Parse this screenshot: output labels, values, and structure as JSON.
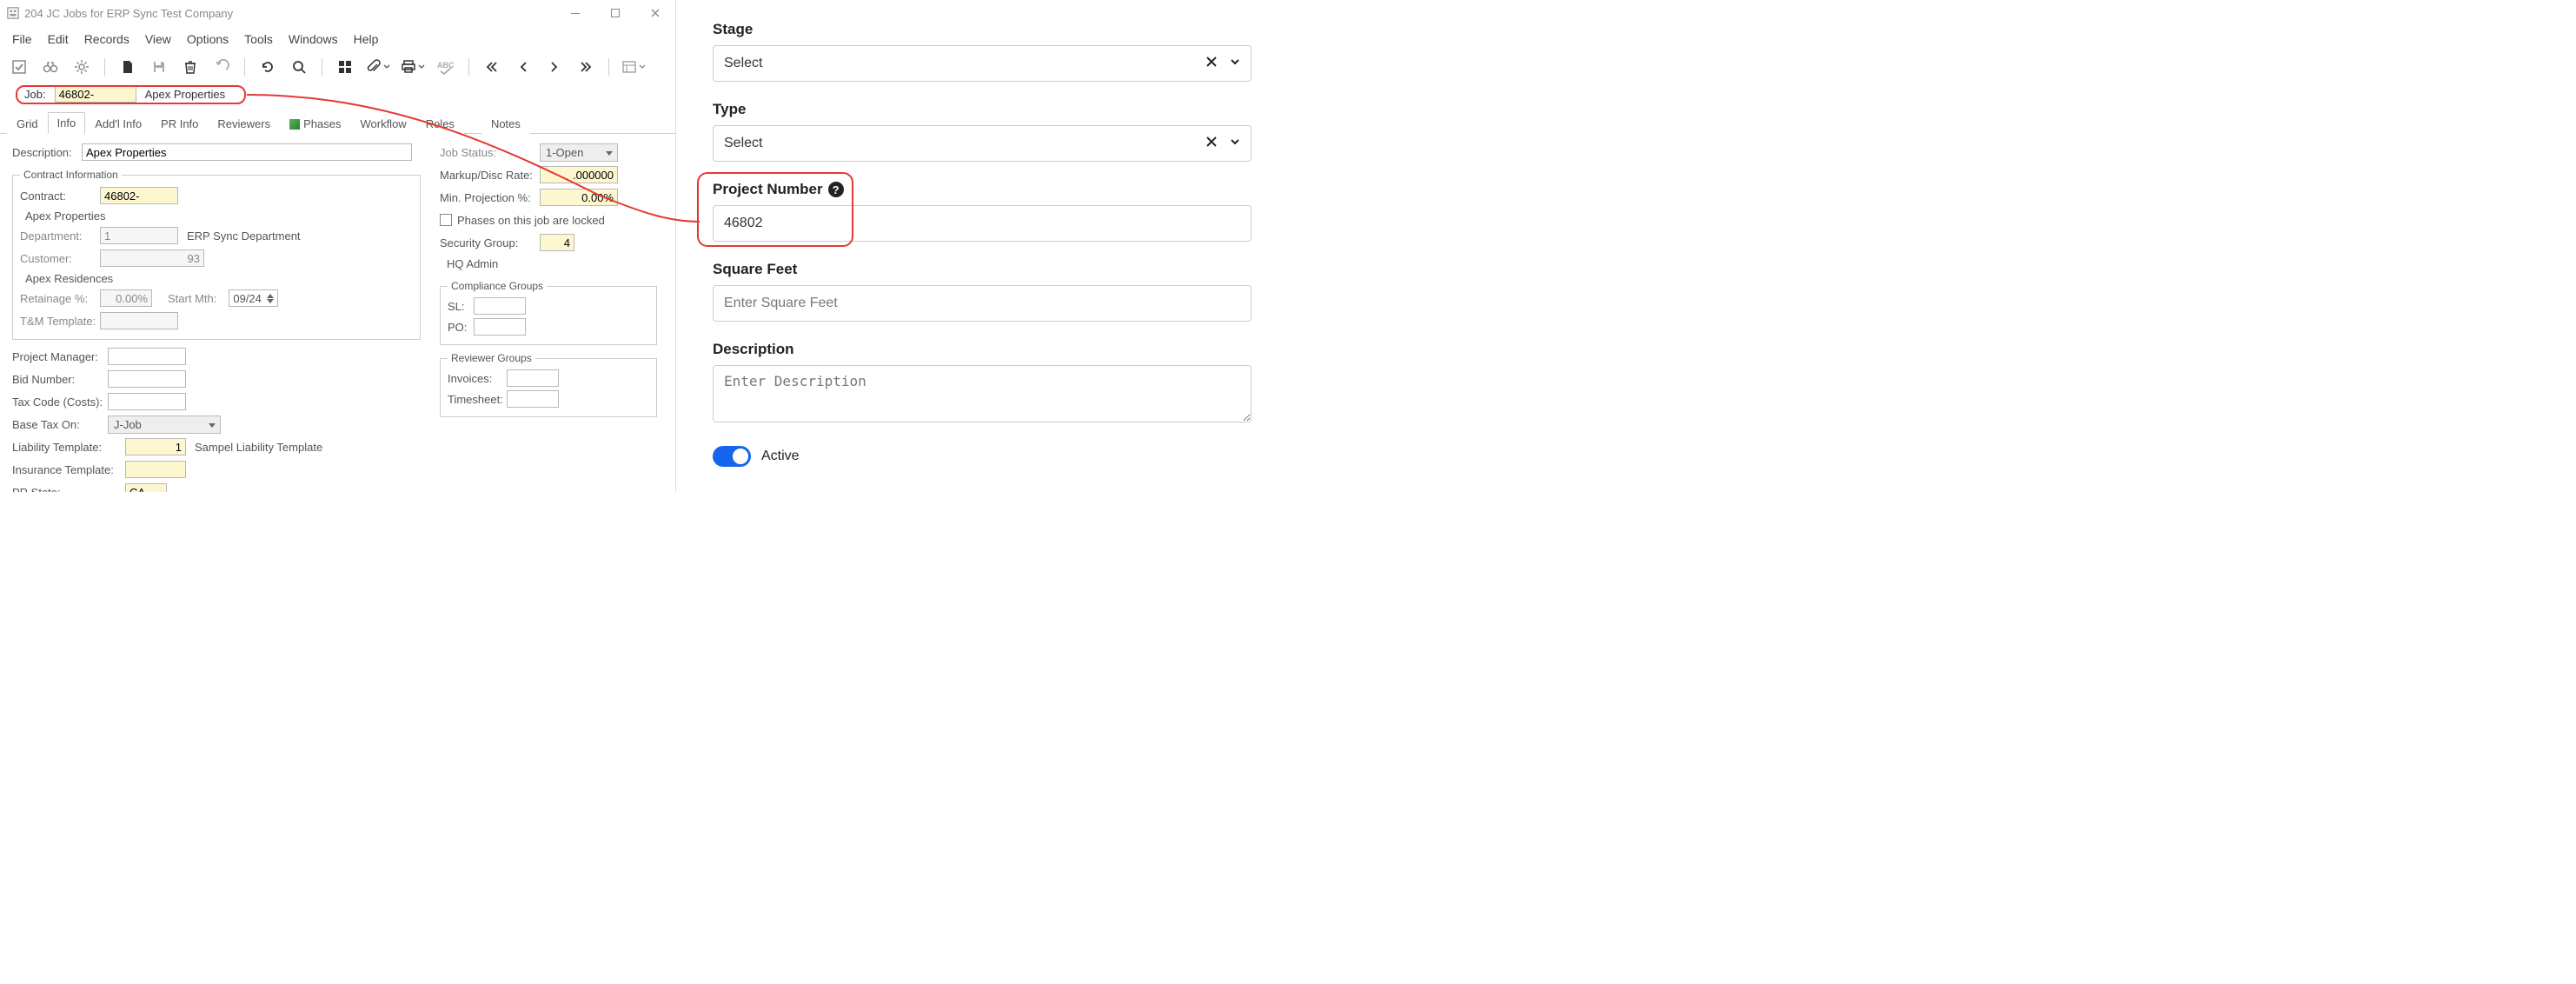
{
  "win": {
    "title": "204 JC Jobs for ERP Sync Test Company",
    "menu": [
      "File",
      "Edit",
      "Records",
      "View",
      "Options",
      "Tools",
      "Windows",
      "Help"
    ],
    "job_label": "Job:",
    "job_value": "46802-",
    "job_name": "Apex Properties",
    "tabs": [
      "Grid",
      "Info",
      "Add'l Info",
      "PR Info",
      "Reviewers",
      "Phases",
      "Workflow",
      "Roles",
      "Notes"
    ],
    "active_tab": 1,
    "description_label": "Description:",
    "description_value": "Apex Properties",
    "contract_info_legend": "Contract Information",
    "contract_label": "Contract:",
    "contract_value": "46802-",
    "contract_name": "Apex Properties",
    "department_label": "Department:",
    "department_value": "1",
    "department_name": "ERP Sync Department",
    "customer_label": "Customer:",
    "customer_value": "93",
    "customer_name": "Apex Residences",
    "retainage_label": "Retainage %:",
    "retainage_value": "0.00%",
    "startmth_label": "Start Mth:",
    "startmth_value": "09/24",
    "tmtemplate_label": "T&M Template:",
    "pm_label": "Project Manager:",
    "bid_label": "Bid Number:",
    "taxcode_label": "Tax Code (Costs):",
    "basetax_label": "Base Tax On:",
    "basetax_value": "J-Job",
    "liability_label": "Liability Template:",
    "liability_value": "1",
    "liability_name": "Sampel Liability Template",
    "insurance_label": "Insurance Template:",
    "prstate_label": "PR State:",
    "prstate_value": "CA",
    "jobstatus_label": "Job Status:",
    "jobstatus_value": "1-Open",
    "markup_label": "Markup/Disc Rate:",
    "markup_value": ".000000",
    "minproj_label": "Min. Projection %:",
    "minproj_value": "0.00%",
    "phaselock_label": "Phases on this job are locked",
    "secgroup_label": "Security Group:",
    "secgroup_value": "4",
    "hqadmin": "HQ Admin",
    "compliance_legend": "Compliance Groups",
    "sl_label": "SL:",
    "po_label": "PO:",
    "reviewer_legend": "Reviewer Groups",
    "invoices_label": "Invoices:",
    "timesheet_label": "Timesheet:"
  },
  "web": {
    "stage_label": "Stage",
    "stage_value": "Select",
    "type_label": "Type",
    "type_value": "Select",
    "projnum_label": "Project Number",
    "projnum_value": "46802",
    "sqft_label": "Square Feet",
    "sqft_placeholder": "Enter Square Feet",
    "desc_label": "Description",
    "desc_placeholder": "Enter Description",
    "active_label": "Active"
  }
}
